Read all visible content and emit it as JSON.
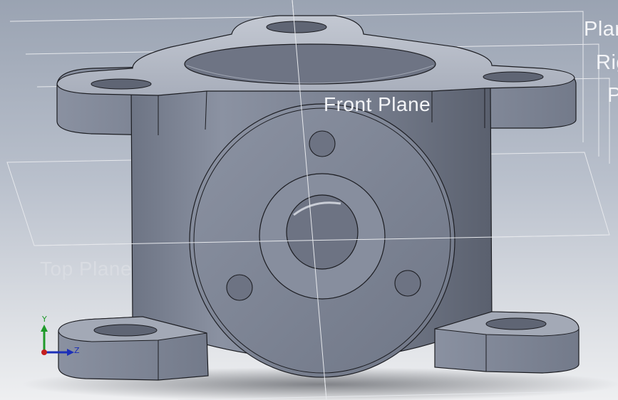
{
  "viewport": {
    "planes": {
      "front": "Front Plane",
      "top": "Top Plane",
      "plane_cut": "Plar",
      "right_cut": "Rig",
      "p_cut": "P"
    },
    "triad": {
      "y": "Y",
      "z": "Z"
    },
    "colors": {
      "background_top": "#9aa3b2",
      "background_bottom": "#eeeff1",
      "part": "#7d8596",
      "edges": "#1c1d22",
      "plane_lines": "#e6e8ec"
    },
    "icons": [
      "cad-part",
      "coordinate-triad-icon"
    ]
  }
}
